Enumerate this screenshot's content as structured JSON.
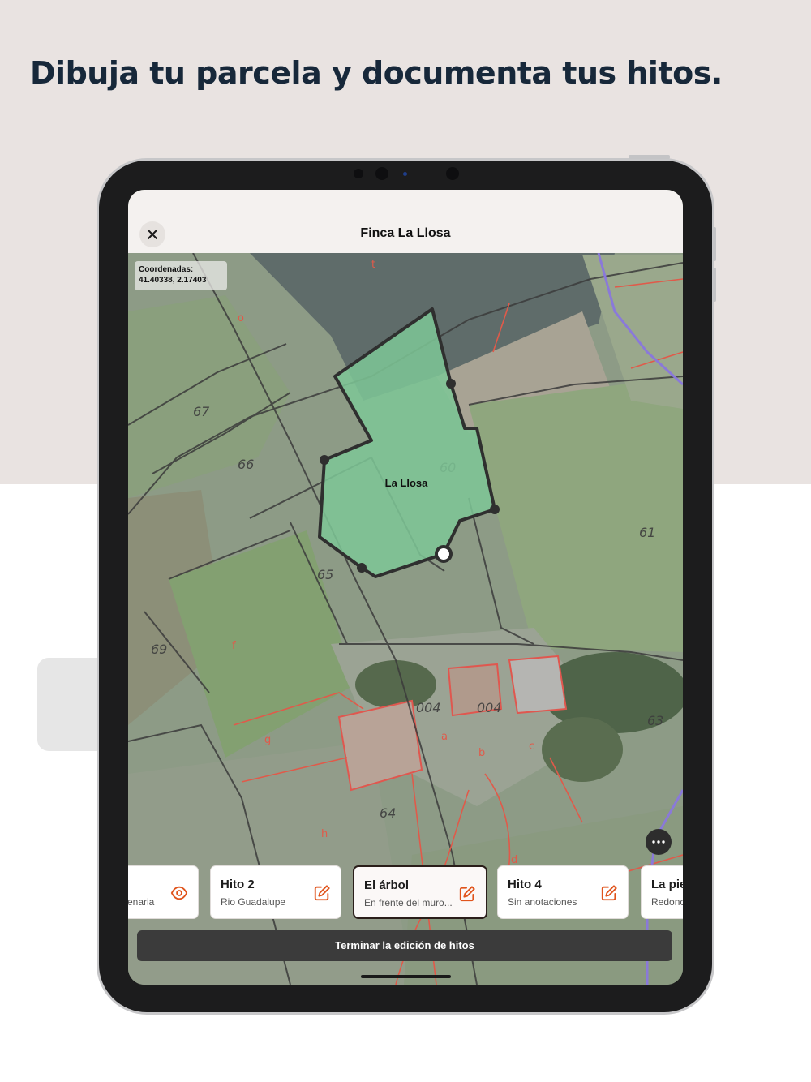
{
  "headline": "Dibuja tu parcela y documenta tus hitos.",
  "sheet": {
    "title": "Finca La Llosa",
    "close_icon": "close-icon"
  },
  "coords": {
    "label": "Coordenadas:",
    "value": "41.40338, 2.17403"
  },
  "parcel": {
    "name": "La Llosa",
    "fill": "#7ec796",
    "stroke": "#2f2f2f"
  },
  "map_labels": {
    "p60": "60",
    "p61": "61",
    "p63": "63",
    "p64": "64",
    "p65": "65",
    "p66": "66",
    "p67": "67",
    "p69": "69",
    "p004a": "004",
    "p004b": "004",
    "la": "a",
    "lb": "b",
    "lc": "c",
    "ld": "d",
    "lf": "f",
    "lg": "g",
    "lh": "h",
    "lo": "o",
    "lt": "t"
  },
  "milestones": [
    {
      "title": "",
      "subtitle": "enaria",
      "icon": "eye-icon"
    },
    {
      "title": "Hito 2",
      "subtitle": "Rio Guadalupe",
      "icon": "edit-icon"
    },
    {
      "title": "El árbol",
      "subtitle": "En frente del muro...",
      "icon": "edit-icon",
      "active": true
    },
    {
      "title": "Hito 4",
      "subtitle": "Sin anotaciones",
      "icon": "edit-icon"
    },
    {
      "title": "La pie",
      "subtitle": "Redonc",
      "icon": "edit-icon"
    }
  ],
  "finish_button": "Terminar la edición de hitos",
  "colors": {
    "accent": "#e0541c",
    "page_bg": "#e9e3e1",
    "headline": "#17283a"
  }
}
